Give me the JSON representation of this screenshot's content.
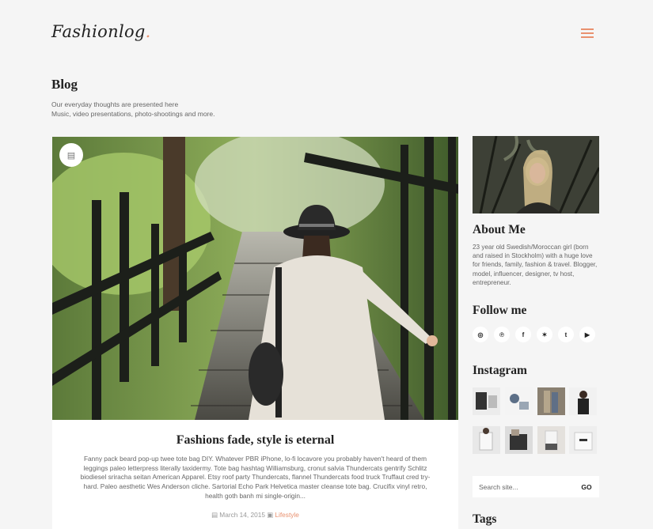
{
  "header": {
    "logo_text": "Fashionlog",
    "logo_dot": ".",
    "menu_icon": "hamburger-icon",
    "accent_color": "#e9916f"
  },
  "page": {
    "title": "Blog",
    "subtitle_line1": "Our everyday thoughts are presented here",
    "subtitle_line2": "Music, video presentations, photo-shootings and more."
  },
  "post": {
    "format_icon": "document-icon",
    "format_glyph": "▤",
    "title": "Fashions fade, style is eternal",
    "excerpt": "Fanny pack beard pop-up twee tote bag DIY. Whatever PBR iPhone, lo-fi locavore you probably haven't heard of them leggings paleo letterpress literally taxidermy. Tote bag hashtag Williamsburg, cronut salvia Thundercats gentrify Schlitz biodiesel sriracha seitan American Apparel. Etsy roof party Thundercats, flannel Thundercats food truck Truffaut cred try-hard. Paleo aesthetic Wes Anderson cliche. Sartorial Echo Park Helvetica master cleanse tote bag. Crucifix vinyl retro, health goth banh mi single-origin...",
    "date": "March 14, 2015",
    "date_icon": "calendar-icon",
    "category": "Lifestyle",
    "category_icon": "folder-icon"
  },
  "sidebar": {
    "about_title": "About Me",
    "about_text": "23 year old Swedish/Moroccan girl (born and raised in Stockholm) with a huge love for friends, family, fashion & travel. Blogger, model, influencer, designer, tv host, entrepreneur.",
    "follow_title": "Follow me",
    "socials": [
      {
        "icon": "instagram-icon",
        "glyph": "◎"
      },
      {
        "icon": "pinterest-icon",
        "glyph": "℗"
      },
      {
        "icon": "facebook-icon",
        "glyph": "f"
      },
      {
        "icon": "twitter-icon",
        "glyph": "✶"
      },
      {
        "icon": "tumblr-icon",
        "glyph": "t"
      },
      {
        "icon": "youtube-icon",
        "glyph": "▶"
      }
    ],
    "instagram_title": "Instagram",
    "search_placeholder": "Search site...",
    "search_button": "GO",
    "tags_title": "Tags"
  }
}
